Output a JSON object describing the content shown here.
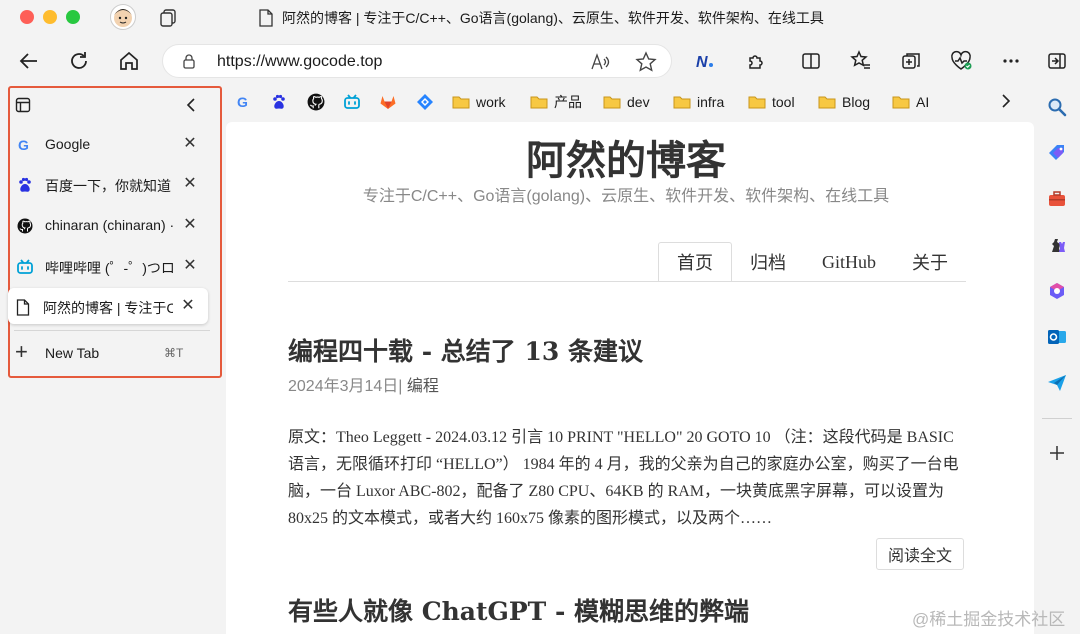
{
  "window": {
    "title": "阿然的博客 | 专注于C/C++、Go语言(golang)、云原生、软件开发、软件架构、在线工具"
  },
  "address_bar": {
    "url": "https://www.gocode.top"
  },
  "tab_pane": {
    "tabs": [
      {
        "label": "Google",
        "icon": "google-icon"
      },
      {
        "label": "百度一下，你就知道",
        "icon": "baidu-icon"
      },
      {
        "label": "chinaran (chinaran) · GitHub",
        "icon": "github-icon"
      },
      {
        "label": "哔哩哔哩 (゜-゜)つロ 干杯~-bilibili",
        "icon": "bilibili-icon"
      },
      {
        "label": "阿然的博客 | 专注于C/C++、Go语言",
        "icon": "page-icon",
        "active": true
      }
    ],
    "new_tab_label": "New Tab",
    "new_tab_shortcut": "⌘T"
  },
  "bookmarks": {
    "icons": [
      "google-icon",
      "baidu-icon",
      "github-icon",
      "bilibili-icon",
      "gitlab-icon",
      "jira-icon"
    ],
    "folders": [
      "work",
      "产品",
      "dev",
      "infra",
      "tool",
      "Blog",
      "AI"
    ]
  },
  "blog": {
    "title": "阿然的博客",
    "subtitle": "专注于C/C++、Go语言(golang)、云原生、软件开发、软件架构、在线工具",
    "nav": [
      "首页",
      "归档",
      "GitHub",
      "关于"
    ],
    "posts": [
      {
        "title": "编程四十载 - 总结了 13 条建议",
        "date": "2024年3月14日",
        "separator": "|",
        "category": "编程",
        "excerpt": "原文：Theo Leggett - 2024.03.12 引言 10 PRINT \"HELLO\" 20 GOTO 10 （注：这段代码是 BASIC 语言，无限循环打印 “HELLO”） 1984 年的 4 月，我的父亲为自己的家庭办公室，购买了一台电脑，一台 Luxor ABC-802，配备了 Z80 CPU、64KB 的 RAM，一块黄底黑字屏幕，可以设置为 80x25 的文本模式，或者大约 160x75 像素的图形模式，以及两个……",
        "read_more": "阅读全文"
      },
      {
        "title": "有些人就像 ChatGPT - 模糊思维的弊端"
      }
    ]
  },
  "watermark": "@稀土掘金技术社区",
  "colors": {
    "highlight_border": "#e55a3c",
    "page_bg": "#ffffff",
    "chrome_bg": "#f3f3f3"
  }
}
